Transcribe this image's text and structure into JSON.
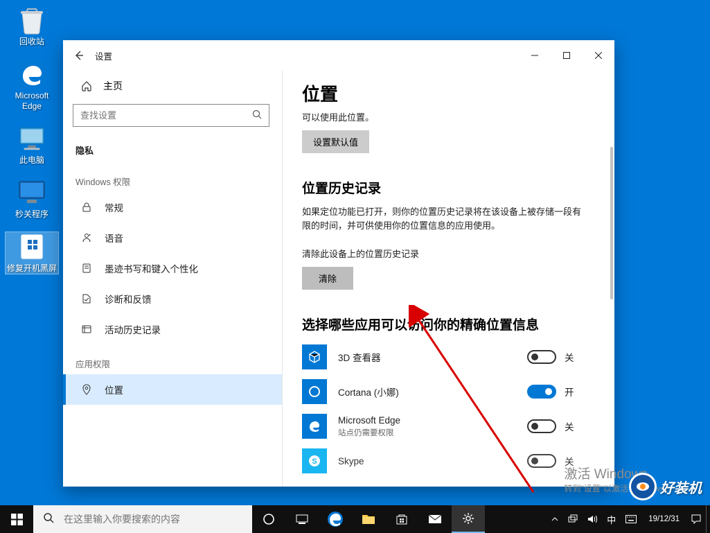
{
  "desktop": {
    "icons": [
      {
        "name": "recycle-bin",
        "label": "回收站"
      },
      {
        "name": "edge",
        "label": "Microsoft Edge"
      },
      {
        "name": "this-pc",
        "label": "此电脑"
      },
      {
        "name": "shutdown-prog",
        "label": "秒关程序"
      },
      {
        "name": "repair-boot",
        "label": "修复开机黑屏"
      }
    ]
  },
  "window": {
    "title": "设置",
    "home": "主页",
    "search_placeholder": "查找设置",
    "section": "隐私",
    "group1": "Windows 权限",
    "group2": "应用权限",
    "nav": {
      "general": "常规",
      "speech": "语音",
      "inking": "墨迹书写和键入个性化",
      "diagnostics": "诊断和反馈",
      "activity": "活动历史记录",
      "location": "位置"
    }
  },
  "content": {
    "page_title": "位置",
    "cut_text": "可以使用此位置。",
    "set_default": "设置默认值",
    "history_title": "位置历史记录",
    "history_desc": "如果定位功能已打开，则你的位置历史记录将在该设备上被存储一段有限的时间，并可供使用你的位置信息的应用使用。",
    "clear_label": "清除此设备上的位置历史记录",
    "clear_btn": "清除",
    "choose_title": "选择哪些应用可以访问你的精确位置信息",
    "apps": [
      {
        "name": "3D 查看器",
        "sub": "",
        "on": false,
        "state": "关"
      },
      {
        "name": "Cortana (小娜)",
        "sub": "",
        "on": true,
        "state": "开"
      },
      {
        "name": "Microsoft Edge",
        "sub": "站点仍需要权限",
        "on": false,
        "state": "关"
      },
      {
        "name": "Skype",
        "sub": "",
        "on": false,
        "state": "关"
      }
    ]
  },
  "watermark": {
    "line1": "激活 Windows",
    "line2": "转到\"设置\"以激活 Windows。"
  },
  "brand": "好装机",
  "taskbar": {
    "search_placeholder": "在这里输入你要搜索的内容",
    "ime": "中",
    "date": "19/12/31"
  }
}
